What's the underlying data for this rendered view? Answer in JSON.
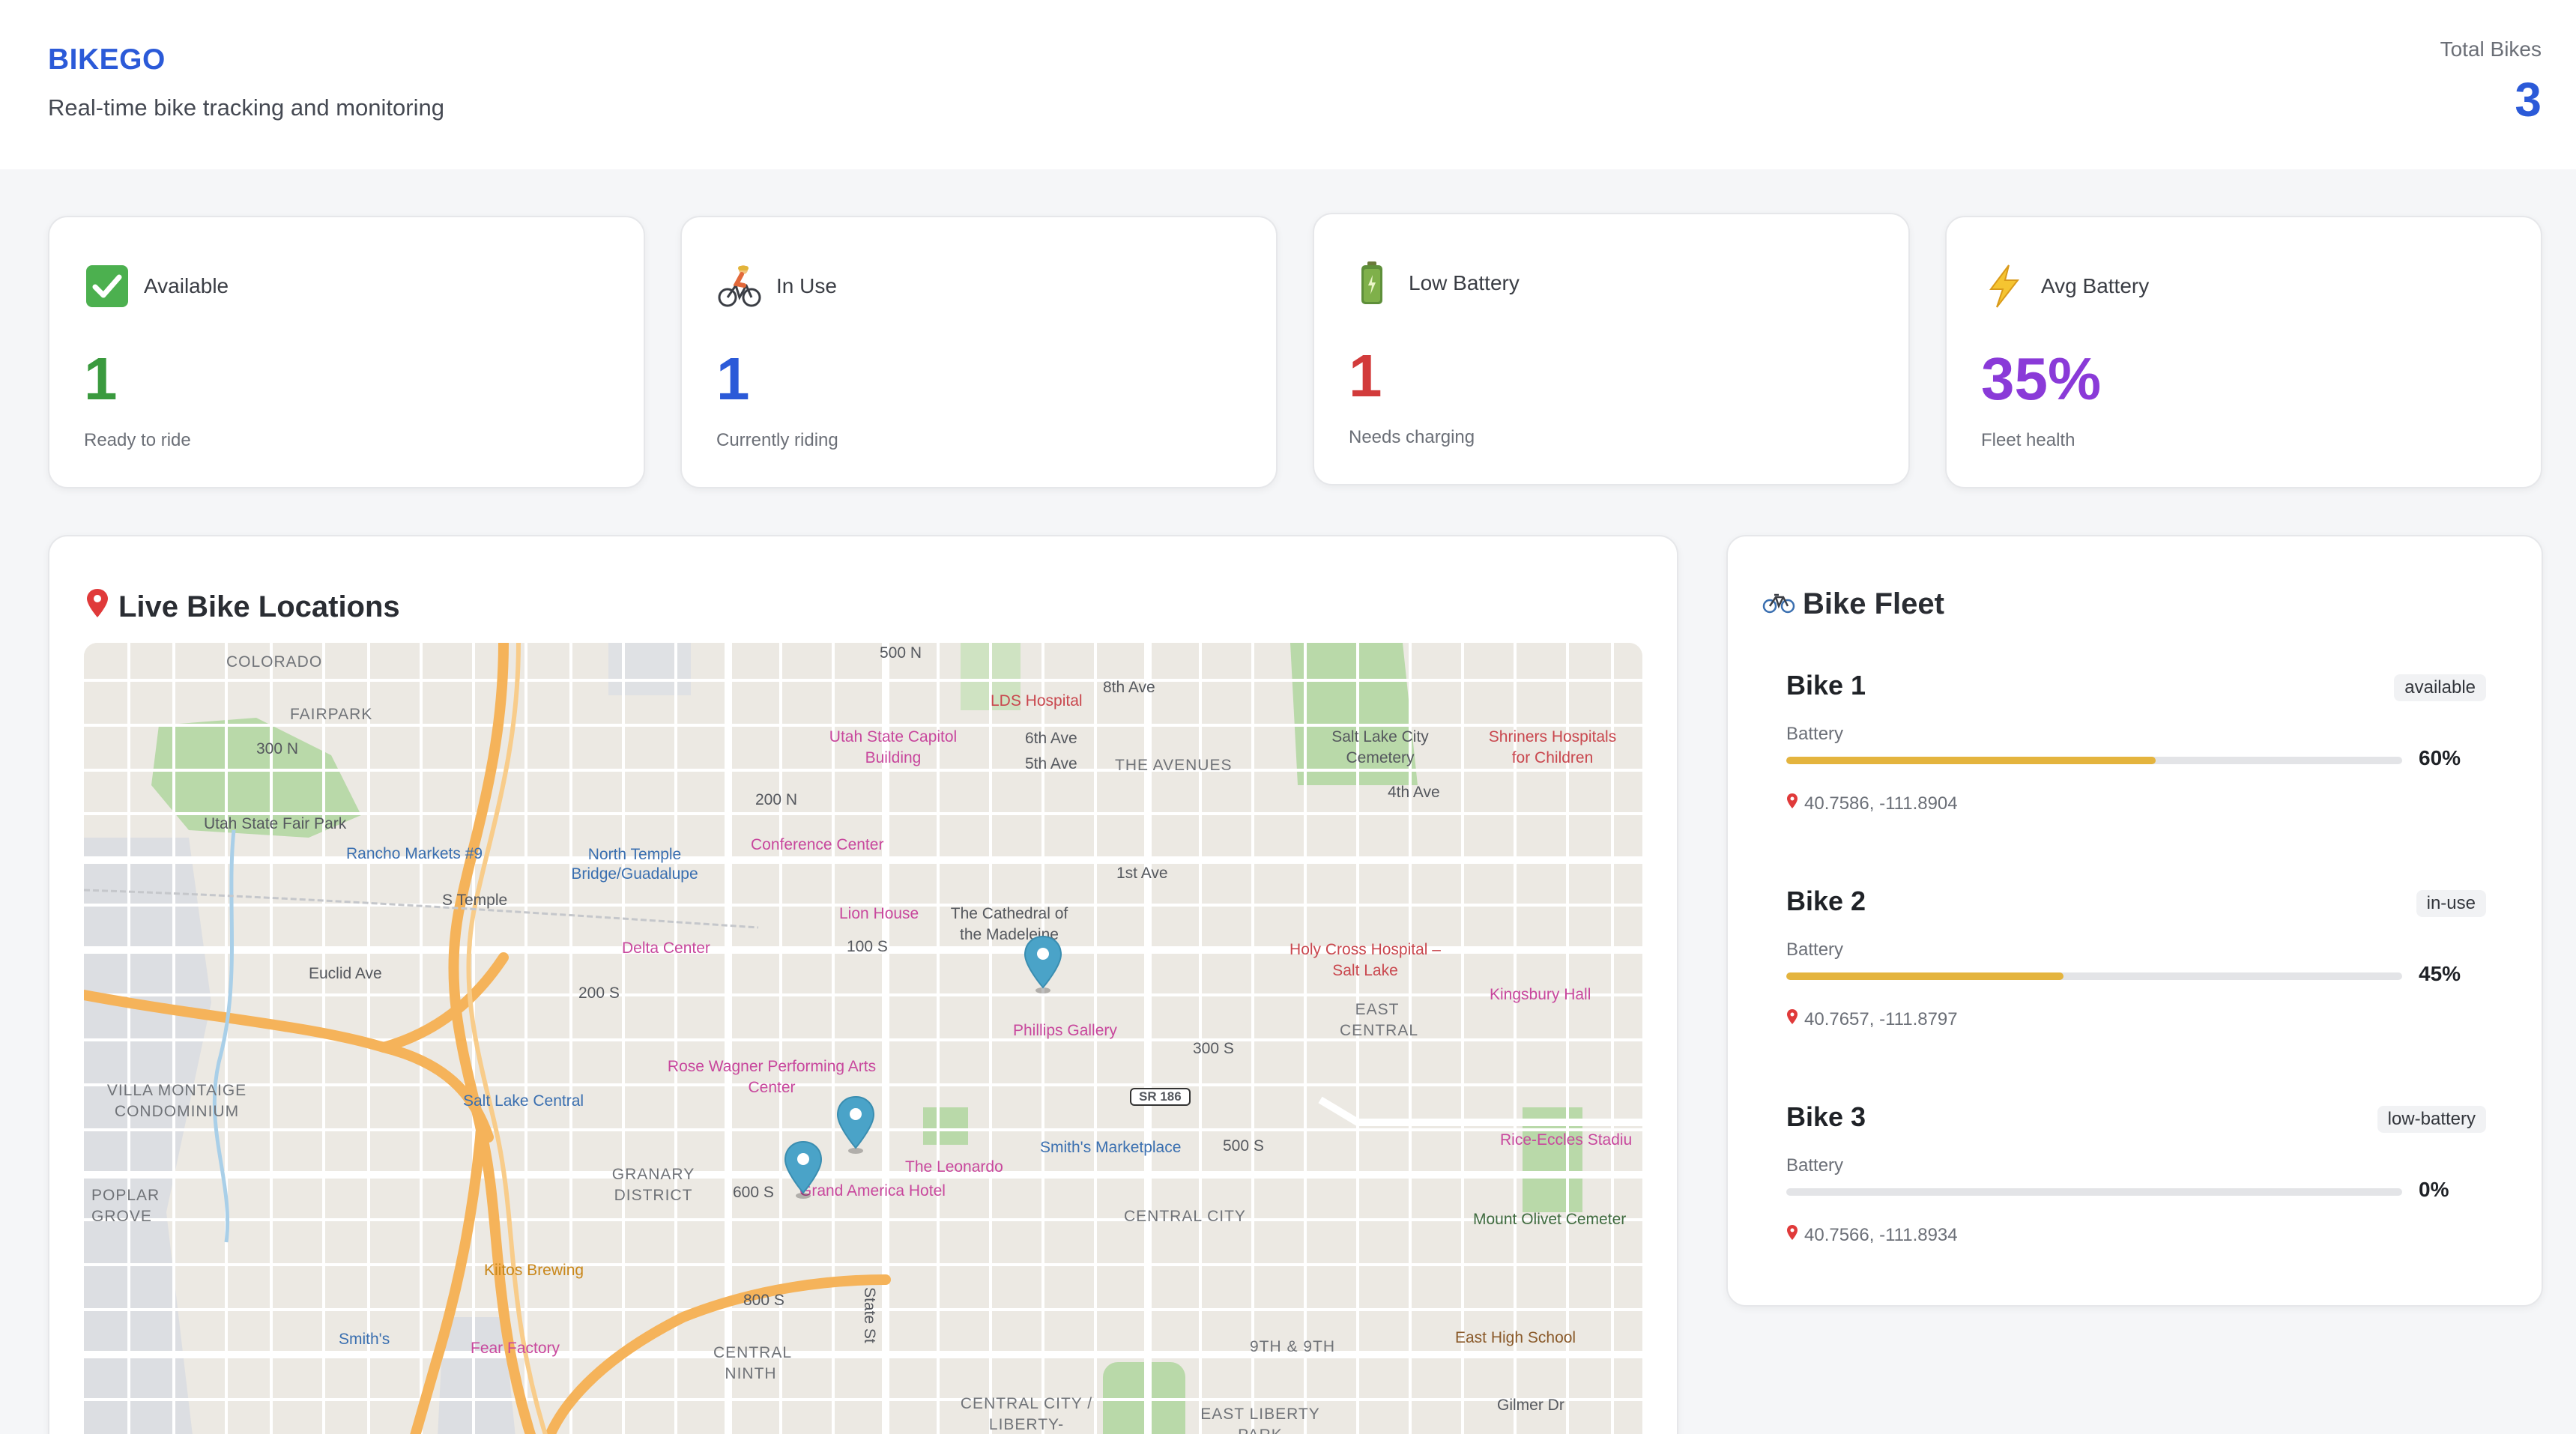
{
  "header": {
    "brand": "BIKEGO",
    "tagline": "Real-time bike tracking and monitoring",
    "total_label": "Total Bikes",
    "total_value": "3"
  },
  "stats": [
    {
      "icon": "check-mark-icon",
      "label": "Available",
      "value": "1",
      "sub": "Ready to ride",
      "color": "#3a9a3e"
    },
    {
      "icon": "cyclist-icon",
      "label": "In Use",
      "value": "1",
      "sub": "Currently riding",
      "color": "#2b5ad8"
    },
    {
      "icon": "battery-icon",
      "label": "Low Battery",
      "value": "1",
      "sub": "Needs charging",
      "color": "#d23b3b"
    },
    {
      "icon": "lightning-icon",
      "label": "Avg Battery",
      "value": "35%",
      "sub": "Fleet health",
      "color": "#8a3ad8"
    }
  ],
  "map_panel": {
    "title": "Live Bike Locations",
    "labels": {
      "colorado": "COLORADO",
      "fairpark": "FAIRPARK",
      "utah_fair_park": "Utah State Fair Park",
      "rancho": "Rancho Markets #9",
      "north_temple": "North Temple Bridge/Guadalupe",
      "conference": "Conference Center",
      "lion_house": "Lion House",
      "delta": "Delta Center",
      "capitol": "Utah State Capitol Building",
      "lds": "LDS Hospital",
      "avenues": "THE AVENUES",
      "cemetery": "Salt Lake City Cemetery",
      "shriners": "Shriners Hospitals for Children",
      "cathedral": "The Cathedral of the Madeleine",
      "holy_cross": "Holy Cross Hospital – Salt Lake",
      "kingsbury": "Kingsbury Hall",
      "east_central": "EAST CENTRAL",
      "phillips": "Phillips Gallery",
      "rose_wagner": "Rose Wagner Performing Arts Center",
      "salt_lake_central": "Salt Lake Central",
      "villa": "VILLA MONTAIGE CONDOMINIUM",
      "granary": "GRANARY DISTRICT",
      "poplar": "POPLAR GROVE",
      "leonardo": "The Leonardo",
      "smiths_market": "Smith's Marketplace",
      "grand_america": "Grand America Hotel",
      "central_city": "CENTRAL CITY",
      "rice_eccles": "Rice-Eccles Stadiu",
      "mount_olivet": "Mount Olivet Cemeter",
      "kiitos": "Kiitos Brewing",
      "smiths": "Smith's",
      "fear_factory": "Fear Factory",
      "central_ninth": "CENTRAL NINTH",
      "ninth_ninth": "9TH & 9TH",
      "east_high": "East High School",
      "central_liberty": "CENTRAL CITY / LIBERTY-",
      "east_liberty": "EAST LIBERTY PARK",
      "sr186": "SR 186",
      "s_temple": "S Temple",
      "st_100s": "100 S",
      "st_200s": "200 S",
      "st_300s": "300 S",
      "st_500s": "500 S",
      "st_600s": "600 S",
      "st_800s": "800 S",
      "st_500n": "500 N",
      "st_300n": "300 N",
      "st_200n": "200 N",
      "first_ave": "1st Ave",
      "fourth_ave": "4th Ave",
      "fifth_ave": "5th Ave",
      "sixth_ave": "6th Ave",
      "eighth_ave": "8th Ave",
      "euclid": "Euclid Ave",
      "gilmer": "Gilmer Dr",
      "state_st": "State St"
    }
  },
  "fleet_panel": {
    "title": "Bike Fleet",
    "battery_label": "Battery",
    "bikes": [
      {
        "name": "Bike 1",
        "status": "available",
        "battery": 60,
        "battery_text": "60%",
        "coords": "40.7586, -111.8904"
      },
      {
        "name": "Bike 2",
        "status": "in-use",
        "battery": 45,
        "battery_text": "45%",
        "coords": "40.7657, -111.8797"
      },
      {
        "name": "Bike 3",
        "status": "low-battery",
        "battery": 0,
        "battery_text": "0%",
        "coords": "40.7566, -111.8934"
      }
    ]
  },
  "colors": {
    "brand": "#2b5ad8",
    "battery_bar": "#e4b43e",
    "map_pin": "#4aa3c8"
  }
}
